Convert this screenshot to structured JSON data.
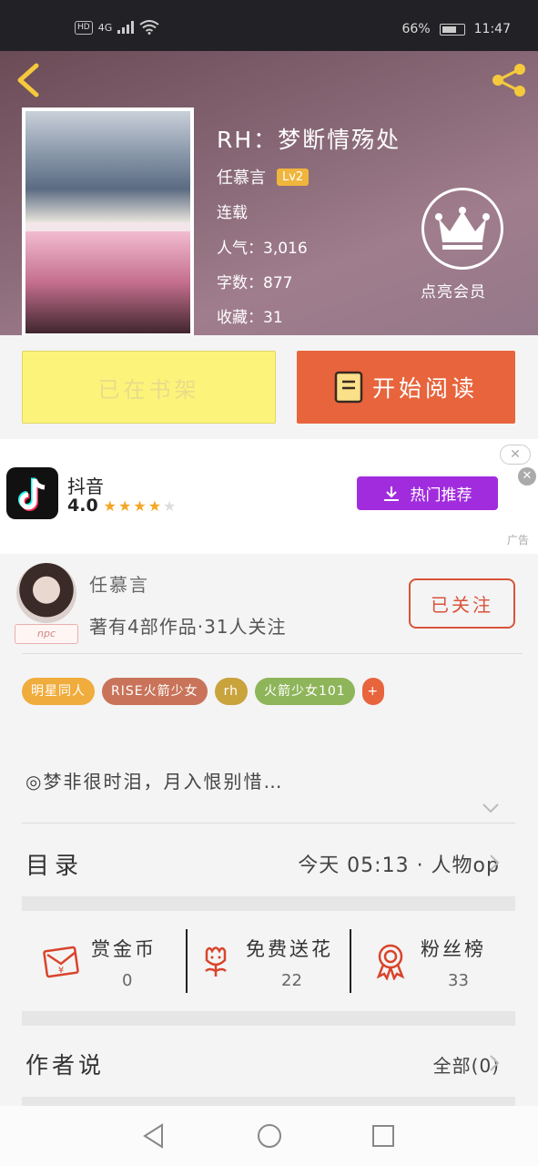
{
  "status_bar": {
    "network_hd": "HD",
    "network_gen": "4G",
    "battery": "66%",
    "time": "11:47"
  },
  "book": {
    "title": "RH：梦断情殇处",
    "author": "任慕言",
    "level": "Lv2",
    "status": "连载",
    "popularity": "人气：3,016",
    "word_count": "字数：877",
    "favorites": "收藏：31",
    "vip_label": "点亮会员"
  },
  "buttons": {
    "shelf": "已在书架",
    "read": "开始阅读"
  },
  "ad": {
    "app_name": "抖音",
    "rating": "4.0",
    "stars_filled": 4,
    "stars_total": 5,
    "cta": "热门推荐",
    "tag": "广告",
    "close_label": "✕"
  },
  "author": {
    "name": "任慕言",
    "avatar_tag": "npc",
    "stats": "著有4部作品·31人关注",
    "follow": "已关注"
  },
  "tags": [
    {
      "label": "明星同人",
      "color": "#f0ac3c"
    },
    {
      "label": "RISE火箭少女",
      "color": "#c9745a"
    },
    {
      "label": "rh",
      "color": "#c9a33c"
    },
    {
      "label": "火箭少女101",
      "color": "#8fb55a"
    },
    {
      "label": "+",
      "color": "#e8643c"
    }
  ],
  "summary": "◎梦非很时泪，月入恨别惜…",
  "catalog": {
    "label": "目录",
    "latest": "今天 05:13 · 人物op"
  },
  "stats": [
    {
      "label": "赏金币",
      "value": "0",
      "icon": "red-envelope-icon"
    },
    {
      "label": "免费送花",
      "value": "22",
      "icon": "flower-icon"
    },
    {
      "label": "粉丝榜",
      "value": "33",
      "icon": "medal-icon"
    }
  ],
  "author_says": {
    "label": "作者说",
    "all": "全部(0)"
  },
  "colors": {
    "accent": "#e8643c",
    "follow": "#d9533b",
    "shelf_bg": "#fcf37a",
    "ad_button": "#a12cde"
  }
}
